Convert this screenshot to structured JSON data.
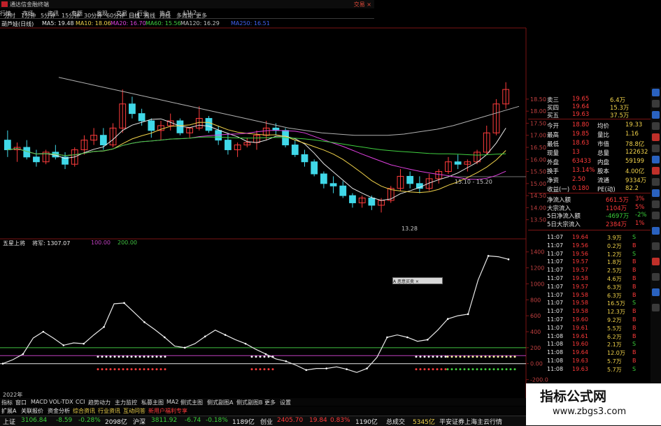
{
  "window": {
    "title": "通达信金融终端",
    "close_label": "交易 ×"
  },
  "tabs": [
    "行情",
    "市场",
    "资讯",
    "专题",
    "发现",
    "交易",
    "行业",
    "热点",
    "L1L2"
  ],
  "periods": [
    "分时",
    "1分钟",
    "5分钟",
    "15分钟",
    "30分钟",
    "60分钟",
    "日线",
    "周线",
    "月线",
    "多周期",
    "更多"
  ],
  "stock_label": "葫芦娃(日线)",
  "ma_legend": [
    {
      "label": "MA5: 19.48",
      "color": "#e8e8e8"
    },
    {
      "label": "MA10: 18.06",
      "color": "#f0d24a"
    },
    {
      "label": "MA20: 16.70",
      "color": "#e040e0"
    },
    {
      "label": "MA60: 15.56",
      "color": "#40d040"
    },
    {
      "label": "MA120: 16.29",
      "color": "#c0c0c0"
    },
    {
      "label": "MA250: 16.51",
      "color": "#4060f0"
    }
  ],
  "main_price_axis": [
    "18.50",
    "18.00",
    "17.50",
    "17.00",
    "16.50",
    "16.00",
    "15.50",
    "15.00",
    "14.50",
    "14.00",
    "13.50"
  ],
  "annotations": {
    "low_price": "13.28",
    "range_label": "15.10 - 15.20",
    "year_label": "2022年"
  },
  "indicator": {
    "name": "五星上将",
    "field": "将军: 1307.07",
    "line1": "100.00",
    "line2": "200.00",
    "axis": [
      "1400",
      "1200",
      "1000",
      "800",
      "600",
      "400",
      "200",
      "0.00",
      "-200.0"
    ]
  },
  "popup_label": "A 恶意买卖 ×",
  "quote": {
    "bids_asks": [
      {
        "k": "卖三",
        "p": "19.65",
        "v": "6.4万"
      },
      {
        "k": "买四",
        "p": "19.64",
        "v": "15.3万"
      },
      {
        "k": "买五",
        "p": "19.63",
        "v": "37.5万"
      }
    ],
    "stats": [
      {
        "k": "今开",
        "v": "18.80",
        "k2": "均价",
        "v2": "19.33"
      },
      {
        "k": "最高",
        "v": "19.85",
        "k2": "量比",
        "v2": "1.16"
      },
      {
        "k": "最低",
        "v": "18.63",
        "k2": "市值",
        "v2": "78.8亿"
      },
      {
        "k": "现量",
        "v": "13",
        "k2": "总量",
        "v2": "122632"
      },
      {
        "k": "外盘",
        "v": "63433",
        "k2": "内盘",
        "v2": "59199"
      },
      {
        "k": "换手",
        "v": "13.14%",
        "k2": "股本",
        "v2": "4.00亿"
      },
      {
        "k": "净资",
        "v": "2.50",
        "k2": "流通",
        "v2": "9334万"
      },
      {
        "k": "收益(一)",
        "v": "0.180",
        "k2": "PE(动)",
        "v2": "82.2"
      }
    ],
    "flows": [
      {
        "k": "净流入额",
        "v": "661.5万",
        "p": "3%"
      },
      {
        "k": "大宗流入",
        "v": "1104万",
        "p": "5%"
      },
      {
        "k": "5日净流入额",
        "v": "-4697万",
        "p": "-2%"
      },
      {
        "k": "5日大宗流入",
        "v": "2384万",
        "p": "1%"
      }
    ]
  },
  "trades": [
    {
      "t": "11:07",
      "p": "19.64",
      "v": "3.9万",
      "s": "S"
    },
    {
      "t": "11:07",
      "p": "19.56",
      "v": "0.2万",
      "s": "B"
    },
    {
      "t": "11:07",
      "p": "19.56",
      "v": "1.2万",
      "s": "S"
    },
    {
      "t": "11:07",
      "p": "19.57",
      "v": "1.8万",
      "s": "B"
    },
    {
      "t": "11:07",
      "p": "19.57",
      "v": "2.5万",
      "s": "B"
    },
    {
      "t": "11:07",
      "p": "19.58",
      "v": "4.6万",
      "s": "B"
    },
    {
      "t": "11:07",
      "p": "19.57",
      "v": "6.3万",
      "s": "B"
    },
    {
      "t": "11:07",
      "p": "19.58",
      "v": "6.3万",
      "s": "B"
    },
    {
      "t": "11:07",
      "p": "19.58",
      "v": "16.5万",
      "s": "S"
    },
    {
      "t": "11:07",
      "p": "19.58",
      "v": "12.3万",
      "s": "B"
    },
    {
      "t": "11:07",
      "p": "19.60",
      "v": "9.2万",
      "s": "B"
    },
    {
      "t": "11:07",
      "p": "19.61",
      "v": "5.5万",
      "s": "B"
    },
    {
      "t": "11:08",
      "p": "19.61",
      "v": "6.2万",
      "s": "B"
    },
    {
      "t": "11:08",
      "p": "19.60",
      "v": "2.1万",
      "s": "S"
    },
    {
      "t": "11:08",
      "p": "19.64",
      "v": "12.0万",
      "s": "B"
    },
    {
      "t": "11:08",
      "p": "19.63",
      "v": "5.7万",
      "s": "B"
    },
    {
      "t": "11:08",
      "p": "19.63",
      "v": "5.7万",
      "s": "S"
    }
  ],
  "bottom_tabs": [
    "指标",
    "窗口",
    "MACD",
    "VOL-TDX",
    "CCI",
    "趋势动力",
    "主力监控",
    "私募主图",
    "MA2",
    "侧式主图",
    "侧式副图A",
    "侧式副图B",
    "更多",
    "设置"
  ],
  "bottom_tabs2": [
    "扩展A",
    "关联报价",
    "资金分析",
    "综合资讯",
    "行业资讯",
    "互动问答",
    "新用户福利专享"
  ],
  "status": [
    {
      "k": "上证",
      "v": "3106.84",
      "c": "-8.59",
      "pct": "-0.28%",
      "amt": "2098亿"
    },
    {
      "k": "沪深",
      "v": "3811.92",
      "c": "-6.74",
      "pct": "-0.18%",
      "amt": "1189亿"
    },
    {
      "k": "创业",
      "v": "2405.70",
      "c": "19.84",
      "pct": "0.83%",
      "amt": "1190亿"
    }
  ],
  "status_extra": {
    "k": "总成交",
    "v": "5345亿",
    "broker": "平安证券上海主云行情"
  },
  "watermark": {
    "title": "指标公式网",
    "url": "www.zbgs3.com"
  },
  "chart_data": [
    {
      "type": "candlestick",
      "title": "葫芦娃(日线)",
      "ylim": [
        13.2,
        18.7
      ],
      "x": [
        "2022"
      ],
      "note": "daily candles with MA5/10/20/60/120/250 overlays",
      "ohlc": [
        [
          16.8,
          17.2,
          16.1,
          16.4
        ],
        [
          16.4,
          16.7,
          15.9,
          16.5
        ],
        [
          16.5,
          16.8,
          16.0,
          16.1
        ],
        [
          16.1,
          16.4,
          15.7,
          15.9
        ],
        [
          15.9,
          16.4,
          15.8,
          16.3
        ],
        [
          16.3,
          16.6,
          16.0,
          16.1
        ],
        [
          16.1,
          16.3,
          15.6,
          15.8
        ],
        [
          15.8,
          16.5,
          15.7,
          16.4
        ],
        [
          16.4,
          17.0,
          16.2,
          16.8
        ],
        [
          16.8,
          17.3,
          16.6,
          17.0
        ],
        [
          17.0,
          17.3,
          16.4,
          16.6
        ],
        [
          16.6,
          17.5,
          16.5,
          17.3
        ],
        [
          17.3,
          18.9,
          17.1,
          18.3
        ],
        [
          18.3,
          18.6,
          17.7,
          17.9
        ],
        [
          17.9,
          18.1,
          17.4,
          17.6
        ],
        [
          17.6,
          17.7,
          16.9,
          17.2
        ],
        [
          17.2,
          17.6,
          16.8,
          17.4
        ],
        [
          17.4,
          17.9,
          17.2,
          17.6
        ],
        [
          17.6,
          17.7,
          17.0,
          17.1
        ],
        [
          17.1,
          17.3,
          16.9,
          17.3
        ],
        [
          17.3,
          18.2,
          17.2,
          17.7
        ],
        [
          17.7,
          17.8,
          17.1,
          17.2
        ],
        [
          17.2,
          17.4,
          16.6,
          16.8
        ],
        [
          16.8,
          17.1,
          16.2,
          16.4
        ],
        [
          16.4,
          16.7,
          16.1,
          16.6
        ],
        [
          16.6,
          16.9,
          16.5,
          16.7
        ],
        [
          16.7,
          17.2,
          16.4,
          17.0
        ],
        [
          17.0,
          17.6,
          16.8,
          17.3
        ],
        [
          17.3,
          17.5,
          17.0,
          17.2
        ],
        [
          17.2,
          17.3,
          16.5,
          16.6
        ],
        [
          16.6,
          16.8,
          16.1,
          16.2
        ],
        [
          16.2,
          16.4,
          15.7,
          15.9
        ],
        [
          15.9,
          16.0,
          15.3,
          15.4
        ],
        [
          15.4,
          15.5,
          14.8,
          15.0
        ],
        [
          15.0,
          15.3,
          14.6,
          14.9
        ],
        [
          14.9,
          15.1,
          14.4,
          14.5
        ],
        [
          14.5,
          14.6,
          14.0,
          14.2
        ],
        [
          14.2,
          14.5,
          14.0,
          14.4
        ],
        [
          14.4,
          14.5,
          13.9,
          14.1
        ],
        [
          14.1,
          14.4,
          13.8,
          14.3
        ],
        [
          14.3,
          14.9,
          14.2,
          14.8
        ],
        [
          14.8,
          15.6,
          14.7,
          15.3
        ],
        [
          15.3,
          15.5,
          14.8,
          15.0
        ],
        [
          15.0,
          15.3,
          14.6,
          14.8
        ],
        [
          14.8,
          15.4,
          14.7,
          15.2
        ],
        [
          15.2,
          15.6,
          15.0,
          15.5
        ],
        [
          15.5,
          16.1,
          15.4,
          15.9
        ],
        [
          15.9,
          16.2,
          15.6,
          15.8
        ],
        [
          15.8,
          16.0,
          15.5,
          15.9
        ],
        [
          15.9,
          16.4,
          15.8,
          16.3
        ],
        [
          16.3,
          17.4,
          16.2,
          17.1
        ],
        [
          17.1,
          18.5,
          17.0,
          18.3
        ],
        [
          18.3,
          19.2,
          18.1,
          18.9
        ]
      ]
    },
    {
      "type": "line",
      "title": "五星上将",
      "ylim": [
        -300,
        1450
      ],
      "series": [
        {
          "name": "将军",
          "values": [
            0,
            50,
            120,
            320,
            400,
            320,
            230,
            260,
            250,
            360,
            460,
            750,
            760,
            640,
            520,
            430,
            330,
            220,
            200,
            250,
            340,
            420,
            360,
            300,
            250,
            180,
            120,
            60,
            30,
            -20,
            -80,
            -60,
            -60,
            -40,
            -70,
            -110,
            -60,
            80,
            330,
            360,
            330,
            280,
            300,
            420,
            560,
            600,
            620,
            1050,
            1350,
            1340,
            1307
          ]
        }
      ]
    }
  ]
}
